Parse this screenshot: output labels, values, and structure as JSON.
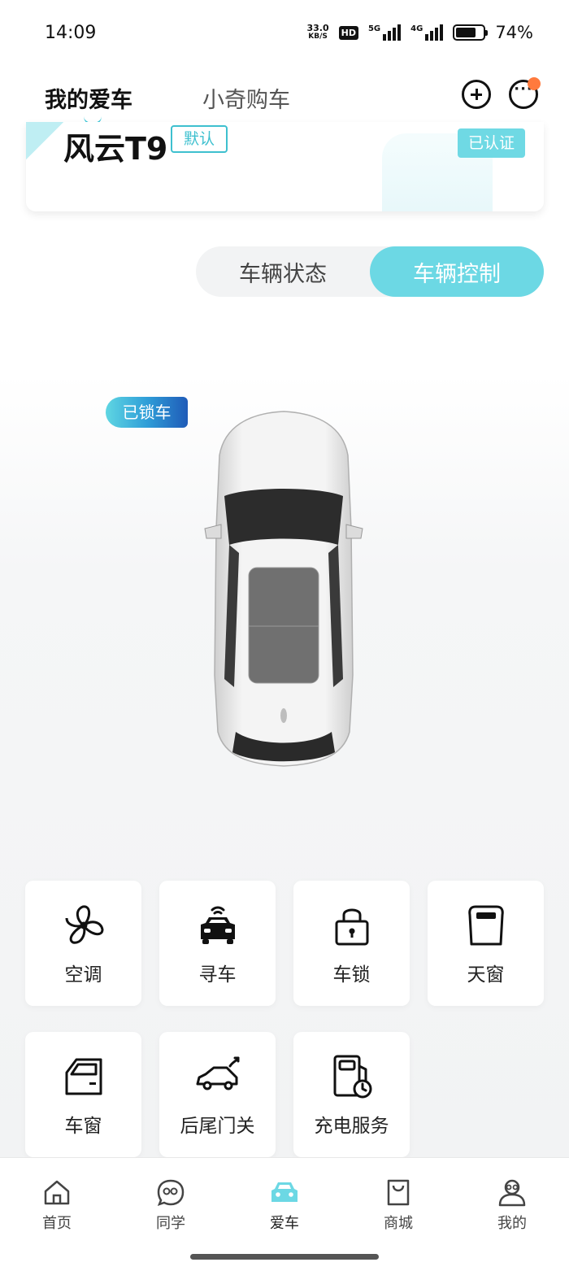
{
  "status_bar": {
    "time": "14:09",
    "net_speed_value": "33.0",
    "net_speed_unit": "KB/S",
    "hd_label": "HD",
    "signal1_tag": "5G",
    "signal2_tag": "4G",
    "battery_percent_text": "74%",
    "battery_level": 0.74
  },
  "top_nav": {
    "tabs": [
      {
        "label": "我的爱车",
        "active": true
      },
      {
        "label": "小奇购车",
        "active": false
      }
    ],
    "add_icon": "plus-circle-icon",
    "message_icon": "chat-bubble-icon",
    "message_badge_color": "#ff7a3d"
  },
  "car_card": {
    "name": "风云T9",
    "default_badge": "默认",
    "verified_badge": "已认证"
  },
  "segments": [
    {
      "label": "车辆状态",
      "active": false
    },
    {
      "label": "车辆控制",
      "active": true
    }
  ],
  "vehicle": {
    "lock_status": "已锁车"
  },
  "controls": [
    {
      "label": "空调",
      "icon": "fan-icon"
    },
    {
      "label": "寻车",
      "icon": "find-car-icon"
    },
    {
      "label": "车锁",
      "icon": "lock-icon"
    },
    {
      "label": "天窗",
      "icon": "sunroof-icon"
    },
    {
      "label": "车窗",
      "icon": "car-window-icon"
    },
    {
      "label": "后尾门关",
      "icon": "tailgate-icon"
    },
    {
      "label": "充电服务",
      "icon": "charging-icon"
    }
  ],
  "bottom_nav": [
    {
      "label": "首页",
      "icon": "home-icon",
      "active": false
    },
    {
      "label": "同学",
      "icon": "community-icon",
      "active": false
    },
    {
      "label": "爱车",
      "icon": "car-icon",
      "active": true
    },
    {
      "label": "商城",
      "icon": "shop-bag-icon",
      "active": false
    },
    {
      "label": "我的",
      "icon": "profile-icon",
      "active": false
    }
  ],
  "colors": {
    "accent": "#6cd8e4",
    "accent_dark": "#3ec0cf"
  }
}
